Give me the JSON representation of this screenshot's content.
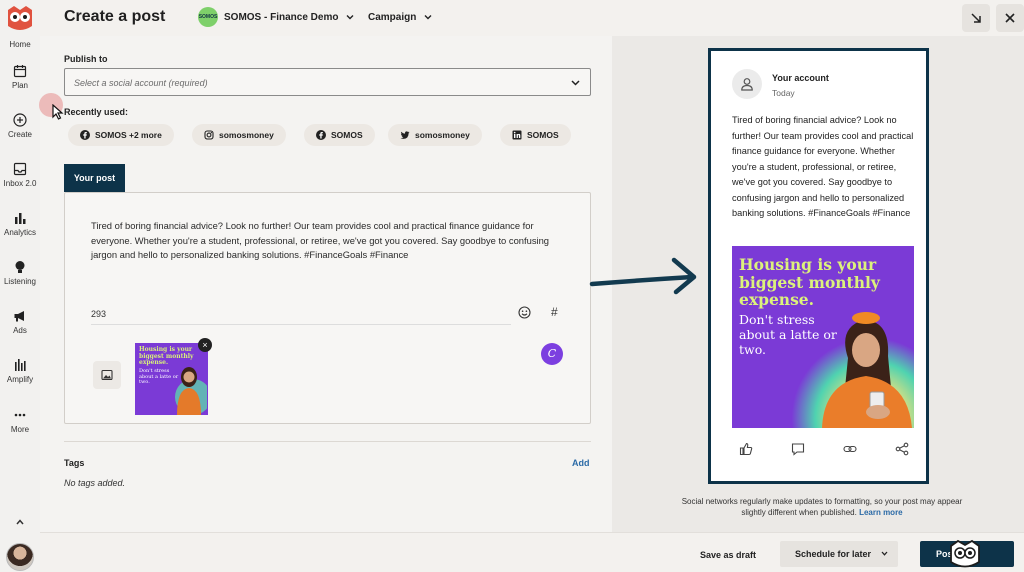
{
  "header": {
    "title": "Create a post",
    "org_name": "SOMOS - Finance Demo",
    "org_badge": "SOMOS",
    "campaign_label": "Campaign"
  },
  "sidebar": {
    "items": [
      {
        "label": "Home",
        "icon": "home-logo-icon"
      },
      {
        "label": "Plan",
        "icon": "calendar-icon"
      },
      {
        "label": "Create",
        "icon": "plus-circle-icon"
      },
      {
        "label": "Inbox 2.0",
        "icon": "inbox-icon"
      },
      {
        "label": "Analytics",
        "icon": "bar-chart-icon"
      },
      {
        "label": "Listening",
        "icon": "lightbulb-icon"
      },
      {
        "label": "Ads",
        "icon": "megaphone-icon"
      },
      {
        "label": "Amplify",
        "icon": "amplify-icon"
      },
      {
        "label": "More",
        "icon": "ellipsis-icon"
      }
    ]
  },
  "composer": {
    "publish_to_label": "Publish to",
    "account_placeholder": "Select a social account (required)",
    "recently_used_label": "Recently used:",
    "recent_accounts": [
      {
        "label": "SOMOS +2 more",
        "network": "facebook"
      },
      {
        "label": "somosmoney",
        "network": "instagram"
      },
      {
        "label": "SOMOS",
        "network": "facebook"
      },
      {
        "label": "somosmoney",
        "network": "twitter"
      },
      {
        "label": "SOMOS",
        "network": "linkedin"
      }
    ],
    "tab_label": "Your post",
    "post_text": "Tired of boring financial advice? Look no further! Our team provides cool and practical finance guidance for everyone. Whether you're a student, professional, or retiree, we've got you covered. Say goodbye to confusing jargon and hello to personalized banking solutions. #FinanceGoals #Finance",
    "char_count": "293",
    "hashtag_symbol": "#",
    "thumbnail": {
      "headline": "Housing is your biggest monthly expense.",
      "sub": "Don't stress about a latte or two."
    },
    "tags_label": "Tags",
    "tags_add": "Add",
    "tags_empty": "No tags added."
  },
  "preview": {
    "account_name": "Your account",
    "date": "Today",
    "post_text": "Tired of boring financial advice? Look no further! Our team provides cool and practical finance guidance for everyone. Whether you're a student, professional, or retiree, we've got you covered. Say goodbye to confusing jargon and hello to personalized banking solutions. #FinanceGoals #Finance",
    "image_headline": "Housing is your biggest monthly expense.",
    "image_sub": "Don't stress about a latte or two.",
    "disclaimer": "Social networks regularly make updates to formatting, so your post may appear slightly different when published.",
    "learn_more": "Learn more"
  },
  "footer": {
    "save_draft": "Save as draft",
    "schedule": "Schedule for later",
    "post_now": "Post now"
  },
  "colors": {
    "primary_navy": "#0d3349",
    "accent_purple": "#7b3ad6",
    "accent_lime": "#dcf27b",
    "link_blue": "#2b6aa6"
  }
}
